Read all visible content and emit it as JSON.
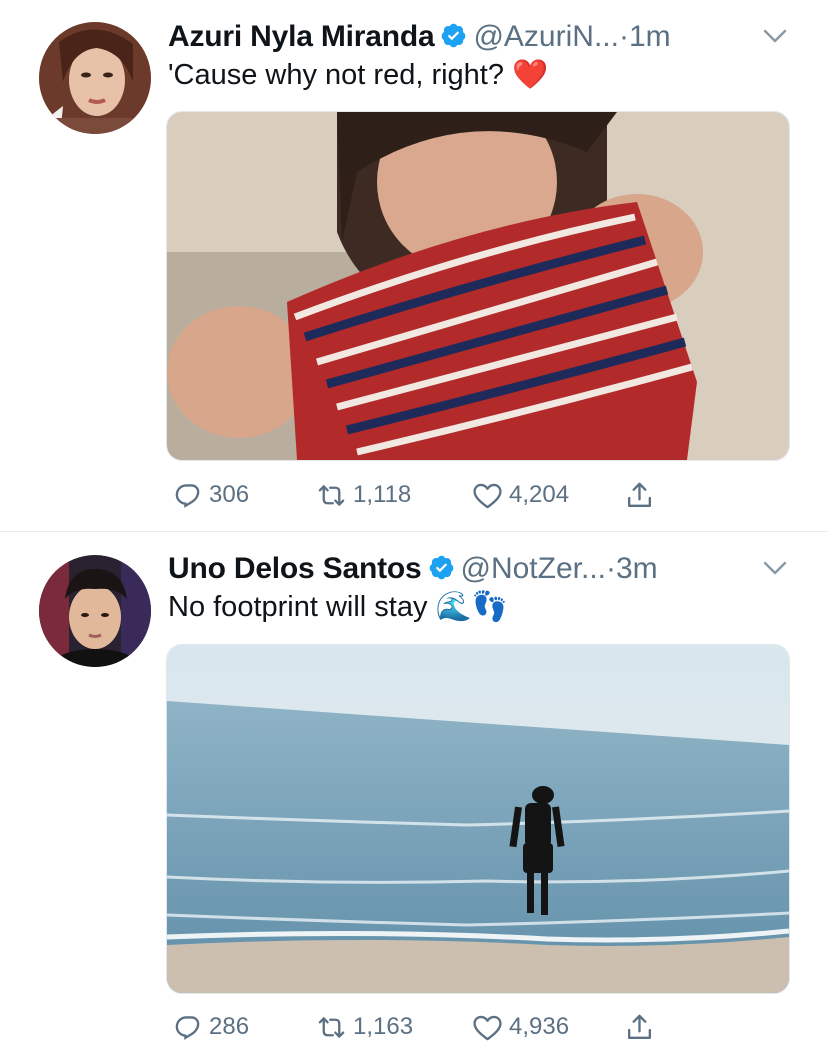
{
  "tweets": [
    {
      "name": "Azuri Nyla Miranda",
      "handle": "@AzuriN...",
      "dot": "·",
      "time": "1m",
      "text": "'Cause why not red, right? ❤️",
      "counts": {
        "replies": "306",
        "retweets": "1,118",
        "likes": "4,204"
      }
    },
    {
      "name": "Uno Delos Santos",
      "handle": "@NotZer...",
      "dot": "·",
      "time": "3m",
      "text": "No footprint will stay 🌊👣",
      "counts": {
        "replies": "286",
        "retweets": "1,163",
        "likes": "4,936"
      }
    }
  ],
  "colors": {
    "verified": "#1da1f2",
    "secondary_text": "#5b7083",
    "primary_text": "#0f1419",
    "divider": "#e6ecf0"
  },
  "icons": [
    "verified-badge-icon",
    "chevron-down-icon",
    "reply-icon",
    "retweet-icon",
    "like-icon",
    "share-icon"
  ]
}
